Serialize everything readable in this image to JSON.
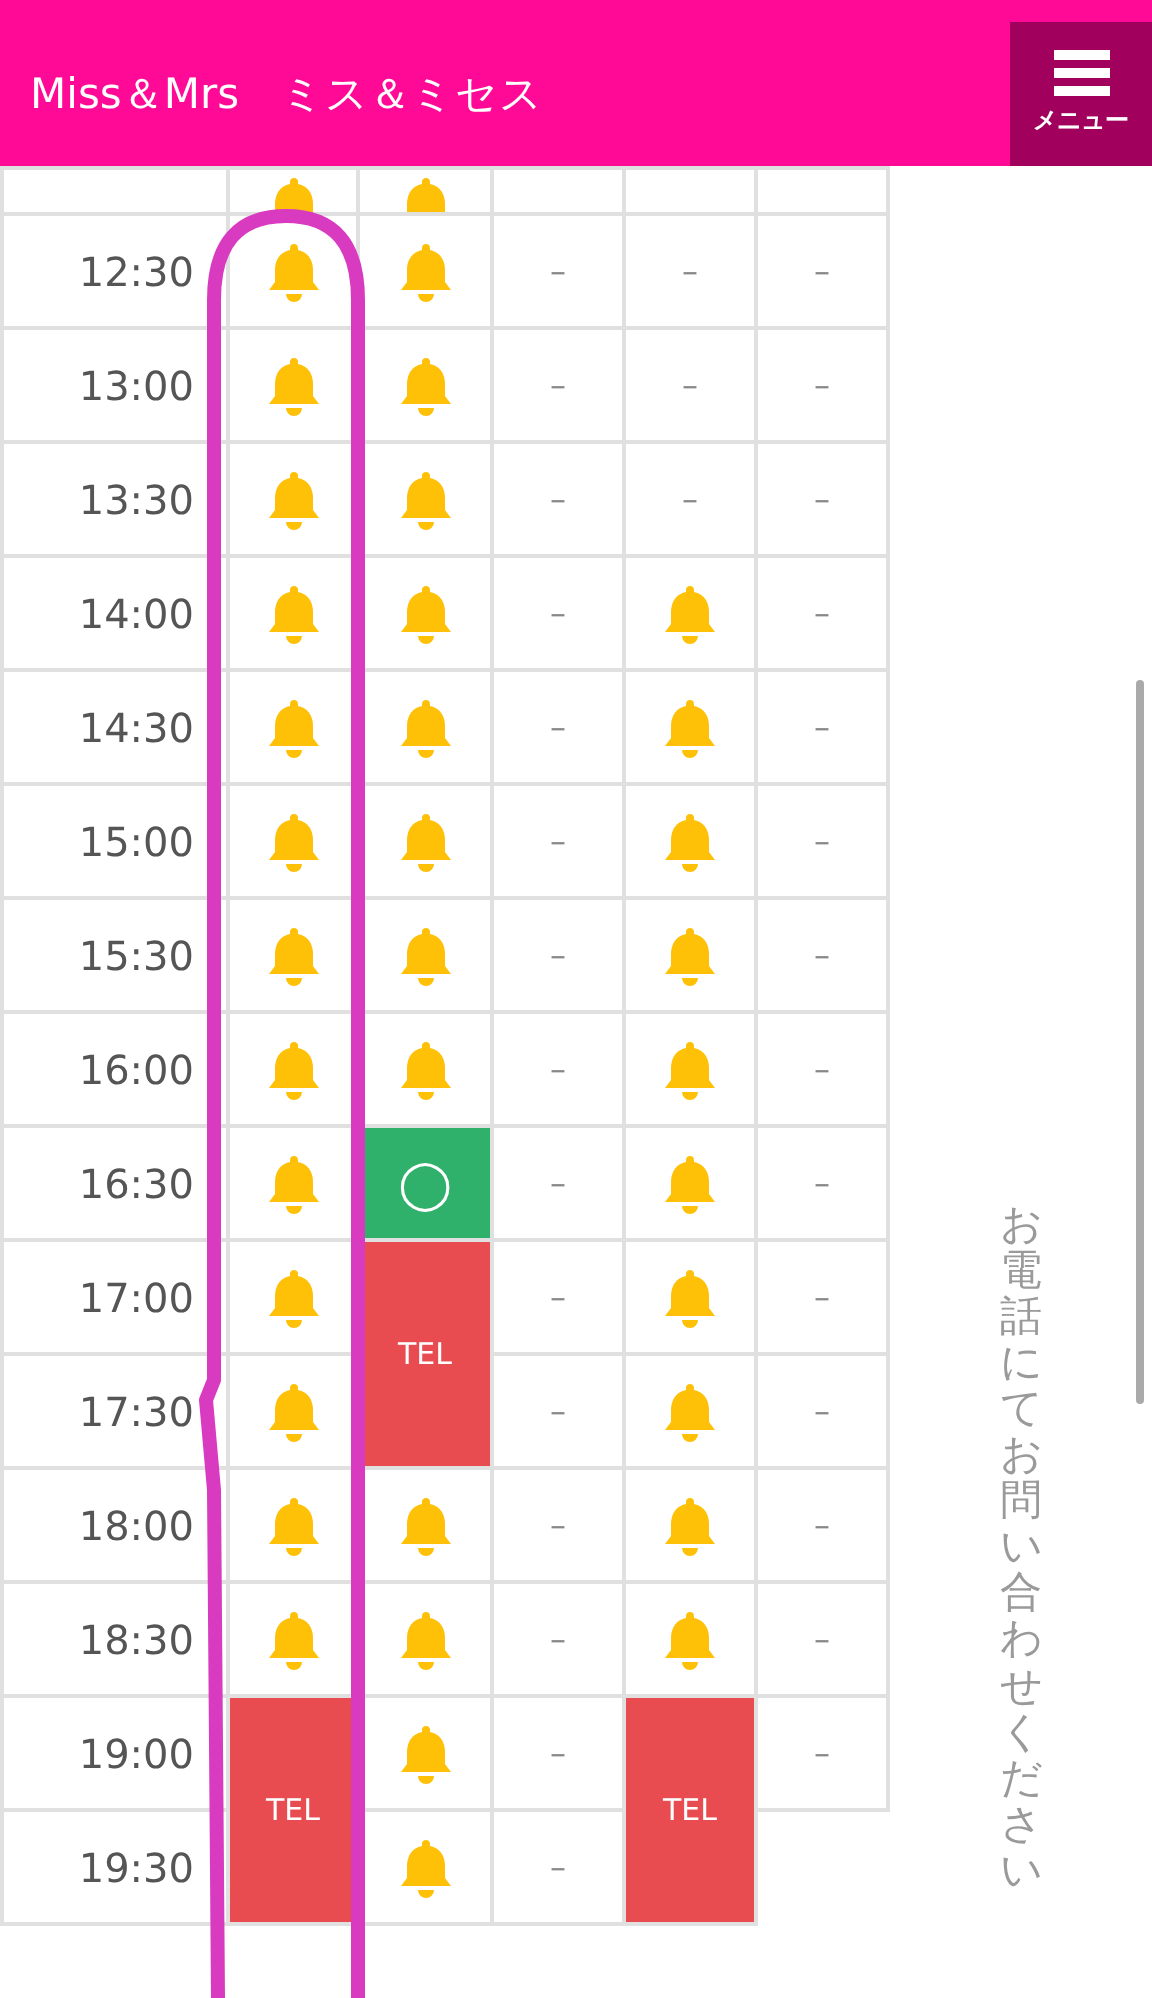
{
  "header": {
    "title": "Miss＆Mrs　ミス＆ミセス",
    "menu_label": "メニュー"
  },
  "schedule": {
    "rows": [
      {
        "clipped": true,
        "cells": [
          {
            "kind": "bell"
          },
          {
            "kind": "bell"
          },
          {
            "kind": "blank"
          },
          {
            "kind": "blank"
          },
          {
            "kind": "blank"
          }
        ]
      },
      {
        "time": "12:30",
        "cells": [
          {
            "kind": "bell"
          },
          {
            "kind": "bell"
          },
          {
            "kind": "dash",
            "text": "–"
          },
          {
            "kind": "dash",
            "text": "–"
          },
          {
            "kind": "dash",
            "text": "–"
          }
        ]
      },
      {
        "time": "13:00",
        "cells": [
          {
            "kind": "bell"
          },
          {
            "kind": "bell"
          },
          {
            "kind": "dash",
            "text": "–"
          },
          {
            "kind": "dash",
            "text": "–"
          },
          {
            "kind": "dash",
            "text": "–"
          }
        ]
      },
      {
        "time": "13:30",
        "cells": [
          {
            "kind": "bell"
          },
          {
            "kind": "bell"
          },
          {
            "kind": "dash",
            "text": "–"
          },
          {
            "kind": "dash",
            "text": "–"
          },
          {
            "kind": "dash",
            "text": "–"
          }
        ]
      },
      {
        "time": "14:00",
        "cells": [
          {
            "kind": "bell"
          },
          {
            "kind": "bell"
          },
          {
            "kind": "dash",
            "text": "–"
          },
          {
            "kind": "bell"
          },
          {
            "kind": "dash",
            "text": "–"
          }
        ]
      },
      {
        "time": "14:30",
        "cells": [
          {
            "kind": "bell"
          },
          {
            "kind": "bell"
          },
          {
            "kind": "dash",
            "text": "–"
          },
          {
            "kind": "bell"
          },
          {
            "kind": "dash",
            "text": "–"
          }
        ]
      },
      {
        "time": "15:00",
        "cells": [
          {
            "kind": "bell"
          },
          {
            "kind": "bell"
          },
          {
            "kind": "dash",
            "text": "–"
          },
          {
            "kind": "bell"
          },
          {
            "kind": "dash",
            "text": "–"
          }
        ]
      },
      {
        "time": "15:30",
        "cells": [
          {
            "kind": "bell"
          },
          {
            "kind": "bell"
          },
          {
            "kind": "dash",
            "text": "–"
          },
          {
            "kind": "bell"
          },
          {
            "kind": "dash",
            "text": "–"
          }
        ]
      },
      {
        "time": "16:00",
        "cells": [
          {
            "kind": "bell"
          },
          {
            "kind": "bell"
          },
          {
            "kind": "dash",
            "text": "–"
          },
          {
            "kind": "bell"
          },
          {
            "kind": "dash",
            "text": "–"
          }
        ]
      },
      {
        "time": "16:30",
        "cells": [
          {
            "kind": "bell"
          },
          {
            "kind": "open",
            "text": "◯"
          },
          {
            "kind": "dash",
            "text": "–"
          },
          {
            "kind": "bell"
          },
          {
            "kind": "dash",
            "text": "–"
          }
        ]
      },
      {
        "time": "17:00",
        "cells": [
          {
            "kind": "bell"
          },
          {
            "kind": "tel",
            "text": "TEL",
            "rowspan": 2
          },
          {
            "kind": "dash",
            "text": "–"
          },
          {
            "kind": "bell"
          },
          {
            "kind": "dash",
            "text": "–"
          }
        ]
      },
      {
        "time": "17:30",
        "cells": [
          {
            "kind": "bell"
          },
          {
            "kind": "dash",
            "text": "–"
          },
          {
            "kind": "bell"
          },
          {
            "kind": "dash",
            "text": "–"
          }
        ]
      },
      {
        "time": "18:00",
        "cells": [
          {
            "kind": "bell"
          },
          {
            "kind": "bell"
          },
          {
            "kind": "dash",
            "text": "–"
          },
          {
            "kind": "bell"
          },
          {
            "kind": "dash",
            "text": "–"
          }
        ]
      },
      {
        "time": "18:30",
        "cells": [
          {
            "kind": "bell"
          },
          {
            "kind": "bell"
          },
          {
            "kind": "dash",
            "text": "–"
          },
          {
            "kind": "bell"
          },
          {
            "kind": "dash",
            "text": "–"
          }
        ]
      },
      {
        "time": "19:00",
        "cells": [
          {
            "kind": "tel",
            "text": "TEL",
            "rowspan": 2
          },
          {
            "kind": "bell"
          },
          {
            "kind": "dash",
            "text": "–"
          },
          {
            "kind": "tel",
            "text": "TEL",
            "rowspan": 2
          },
          {
            "kind": "dash",
            "text": "–"
          }
        ]
      },
      {
        "time": "19:30",
        "cells": [
          {
            "kind": "bell"
          },
          {
            "kind": "dash",
            "text": "–"
          }
        ]
      }
    ]
  },
  "side_note": "お電話にてお問い合わせください"
}
